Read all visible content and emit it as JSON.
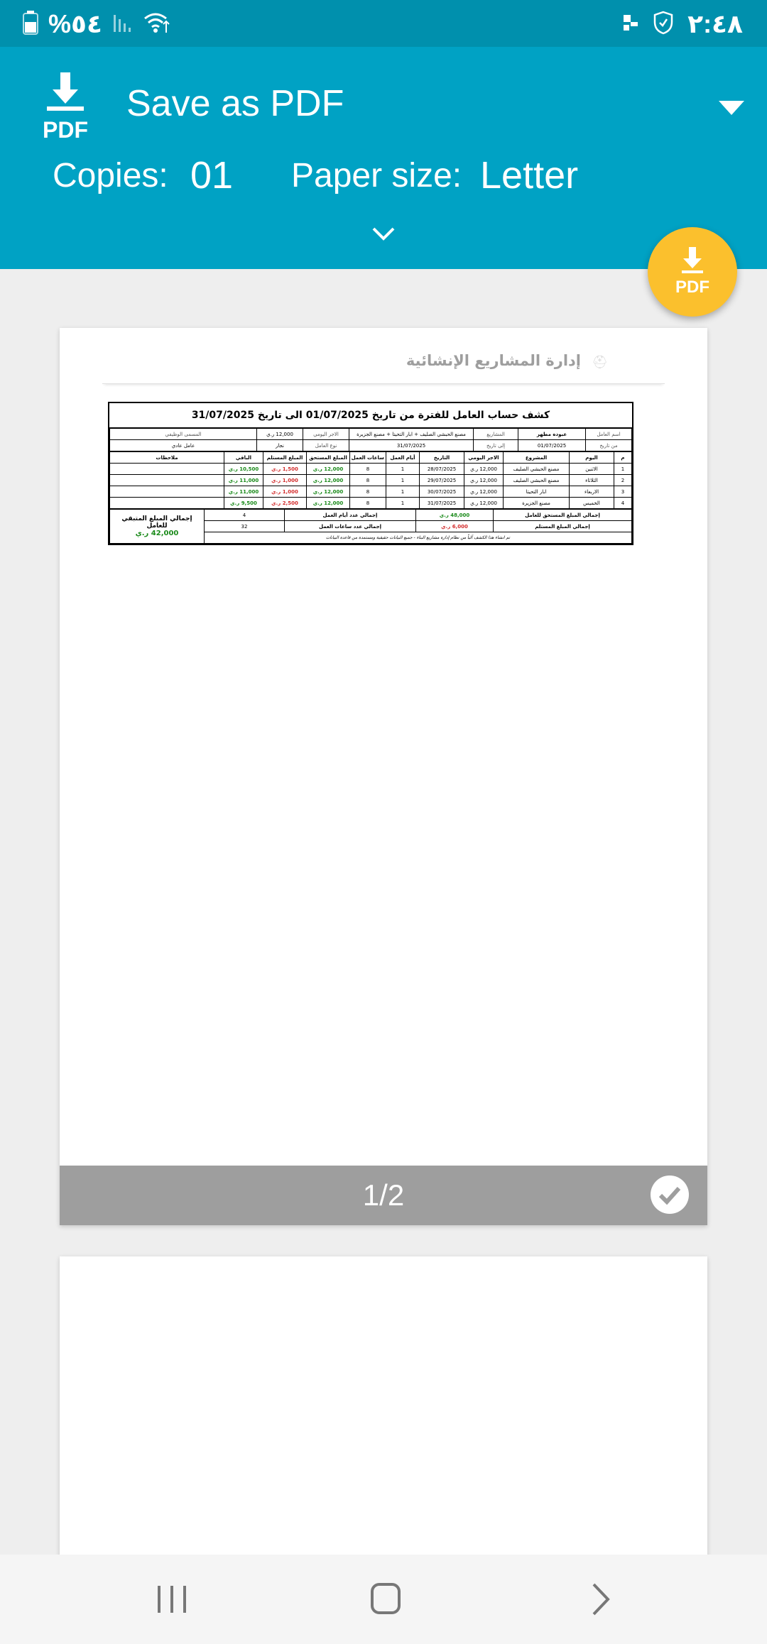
{
  "status_bar": {
    "battery": "%٥٤",
    "time": "٢:٤٨"
  },
  "header": {
    "title": "Save as PDF",
    "pdf_icon_text": "PDF",
    "copies_label": "Copies:",
    "copies_value": "01",
    "paper_size_label": "Paper size:",
    "paper_size_value": "Letter",
    "fab_text": "PDF"
  },
  "colors": {
    "header": "#00a2c4",
    "status_bar": "#0090ad",
    "fab": "#fbc02d",
    "green": "#1a8a1a",
    "red": "#d32f2f"
  },
  "page1": {
    "page_indicator": "1/2",
    "doc_header_title": "إدارة المشاريع الإنشائية",
    "sheet_title": "كشف حساب العامل للفترة من تاريخ 01/07/2025 الى تاريخ 31/07/2025",
    "info": {
      "worker_name_label": "اسم العامل",
      "worker_name": "عبوده مطهر",
      "projects_label": "المشاريع",
      "projects": "مصنع الحبشي الصليف + ابار التحيتا + مصنع الجزيرة",
      "daily_wage_label": "الاجر اليومي",
      "daily_wage": "12,000 ر.ي",
      "job_title_label": "المسمى الوظيفي",
      "from_date_label": "من تاريخ",
      "from_date": "01/07/2025",
      "to_date_label": "إلى تاريخ",
      "to_date": "31/07/2025",
      "worker_type_label": "نوع العامل",
      "worker_type": "نجار",
      "worker_category": "عامل عادي"
    },
    "columns": [
      "م",
      "اليوم",
      "المشروع",
      "الاجر اليومي",
      "التاريخ",
      "أيام العمل",
      "ساعات العمل",
      "المبلغ المستحق",
      "المبلغ المستلم",
      "الباقي",
      "ملاحظات"
    ],
    "rows": [
      {
        "n": "1",
        "day": "الاثنين",
        "project": "مصنع الحبشي الصليف",
        "wage": "12,000 ر.ي",
        "date": "28/07/2025",
        "days": "1",
        "hours": "8",
        "due": "12,000 ر.ي",
        "received": "1,500 ر.ي",
        "remaining": "10,500 ر.ي",
        "notes": ""
      },
      {
        "n": "2",
        "day": "الثلاثاء",
        "project": "مصنع الحبشي الصليف",
        "wage": "12,000 ر.ي",
        "date": "29/07/2025",
        "days": "1",
        "hours": "8",
        "due": "12,000 ر.ي",
        "received": "1,000 ر.ي",
        "remaining": "11,000 ر.ي",
        "notes": ""
      },
      {
        "n": "3",
        "day": "الاربعاء",
        "project": "ابار التحيتا",
        "wage": "12,000 ر.ي",
        "date": "30/07/2025",
        "days": "1",
        "hours": "8",
        "due": "12,000 ر.ي",
        "received": "1,000 ر.ي",
        "remaining": "11,000 ر.ي",
        "notes": ""
      },
      {
        "n": "4",
        "day": "الخميس",
        "project": "مصنع الجزيرة",
        "wage": "12,000 ر.ي",
        "date": "31/07/2025",
        "days": "1",
        "hours": "8",
        "due": "12,000 ر.ي",
        "received": "2,500 ر.ي",
        "remaining": "9,500 ر.ي",
        "notes": ""
      }
    ],
    "summary": {
      "total_due_label": "إجمالي المبلغ المستحق للعامل",
      "total_due": "48,000 ر.ي",
      "total_days_label": "إجمالي عدد أيام العمل",
      "total_days": "4",
      "total_received_label": "إجمالي المبلغ المستلم",
      "total_received": "6,000 ر.ي",
      "total_hours_label": "إجمالي عدد ساعات العمل",
      "total_hours": "32",
      "remaining_label": "إجمالي المبلغ المتبقي للعامل",
      "remaining": "42,000 ر.ي",
      "note": "تم انشاء هذا الكشف آلياً من نظام إدارة مشاريع البناء - جميع البيانات حقيقية ومستمدة من قاعدة البيانات"
    }
  }
}
